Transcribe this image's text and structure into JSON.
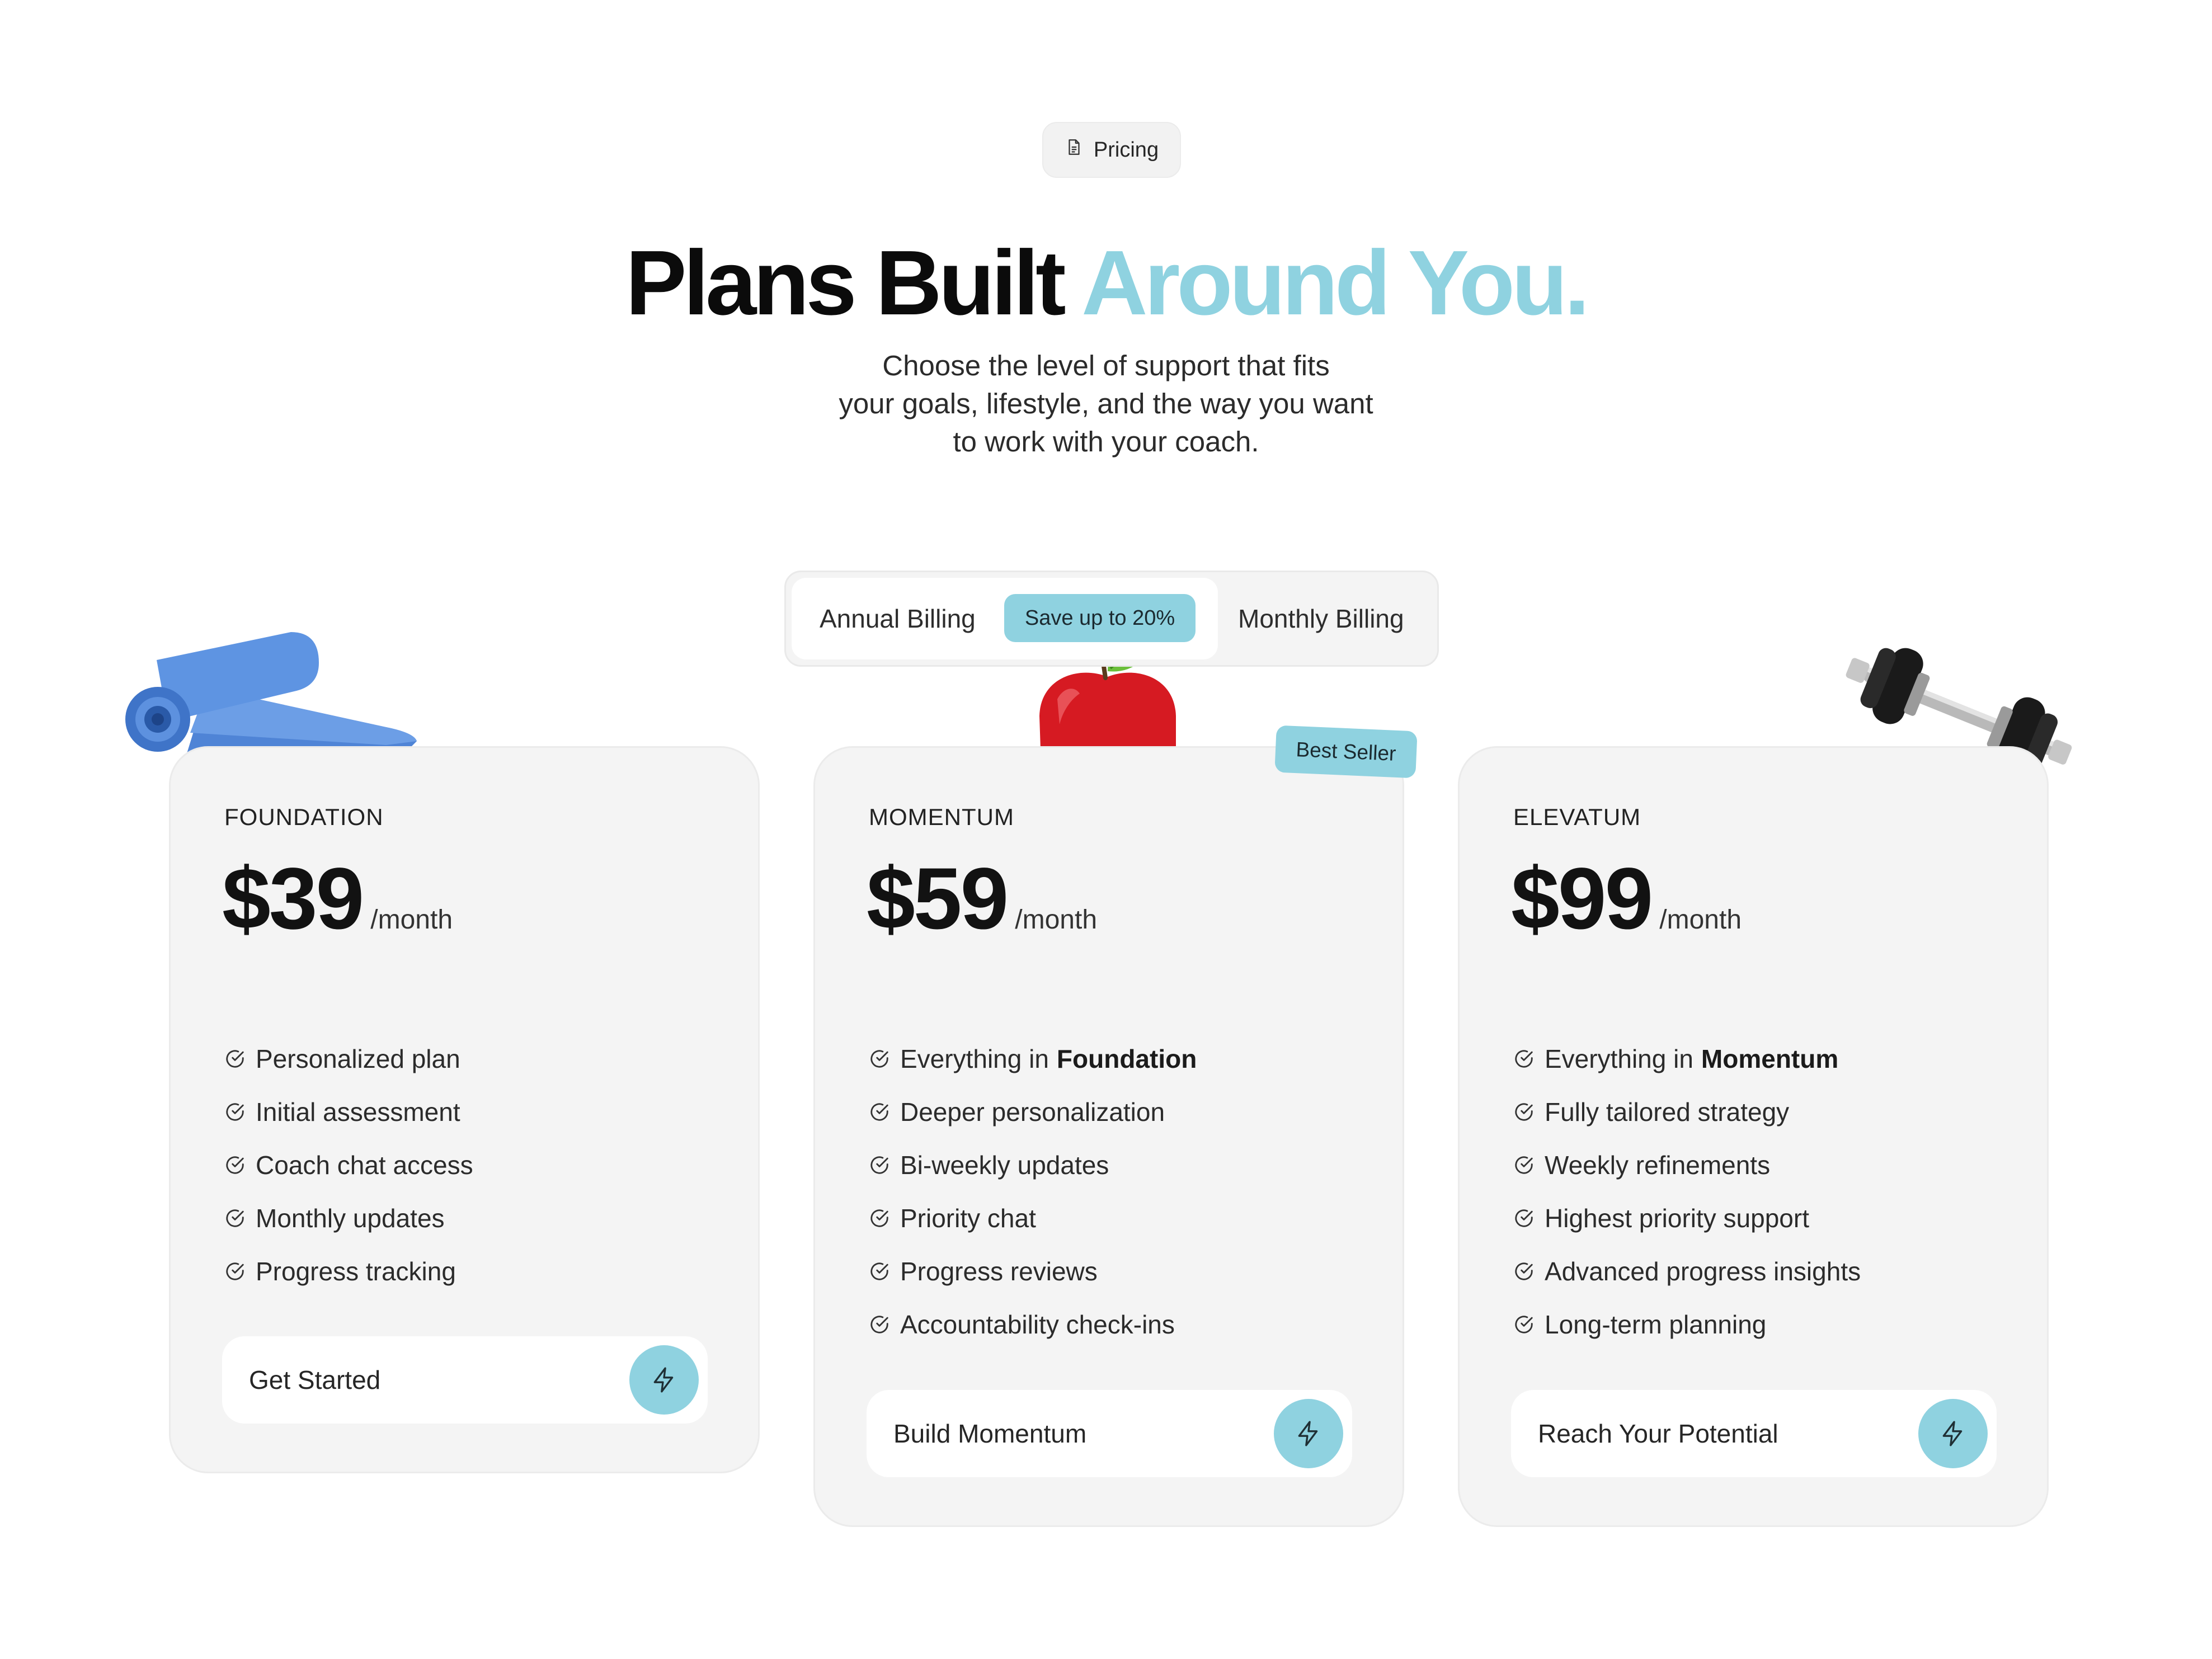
{
  "colors": {
    "accent": "#8fd2e0",
    "card_bg": "#f4f4f4",
    "text": "#1c1c1c"
  },
  "badge": {
    "icon": "document-icon",
    "label": "Pricing"
  },
  "headline": {
    "main": "Plans Built",
    "accent": "Around You."
  },
  "subtitle": {
    "line1": "Choose the level of support that fits",
    "line2": "your goals, lifestyle, and the way you want",
    "line3": "to work with your coach."
  },
  "billing_toggle": {
    "annual_label": "Annual Billing",
    "save_label": "Save up to 20%",
    "monthly_label": "Monthly Billing",
    "selected": "annual"
  },
  "plans": [
    {
      "name": "FOUNDATION",
      "price": "$39",
      "period": "/month",
      "features": [
        {
          "text": "Personalized plan",
          "bold": ""
        },
        {
          "text": "Initial assessment",
          "bold": ""
        },
        {
          "text": "Coach chat access",
          "bold": ""
        },
        {
          "text": "Monthly updates",
          "bold": ""
        },
        {
          "text": "Progress tracking",
          "bold": ""
        }
      ],
      "cta": "Get Started",
      "decoration": "yoga-mat"
    },
    {
      "name": "MOMENTUM",
      "price": "$59",
      "period": "/month",
      "badge": "Best Seller",
      "features": [
        {
          "text": "Everything in",
          "bold": "Foundation"
        },
        {
          "text": "Deeper personalization",
          "bold": ""
        },
        {
          "text": "Bi-weekly updates",
          "bold": ""
        },
        {
          "text": "Priority chat",
          "bold": ""
        },
        {
          "text": "Progress reviews",
          "bold": ""
        },
        {
          "text": "Accountability check-ins",
          "bold": ""
        }
      ],
      "cta": "Build Momentum",
      "decoration": "apple"
    },
    {
      "name": "ELEVATUM",
      "price": "$99",
      "period": "/month",
      "features": [
        {
          "text": "Everything in",
          "bold": "Momentum"
        },
        {
          "text": "Fully tailored strategy",
          "bold": ""
        },
        {
          "text": "Weekly refinements",
          "bold": ""
        },
        {
          "text": "Highest priority support",
          "bold": ""
        },
        {
          "text": "Advanced progress insights",
          "bold": ""
        },
        {
          "text": "Long-term planning",
          "bold": ""
        }
      ],
      "cta": "Reach Your Potential",
      "decoration": "dumbbell"
    }
  ],
  "icons": {
    "feature": "check-circle-icon",
    "cta": "lightning-icon"
  }
}
